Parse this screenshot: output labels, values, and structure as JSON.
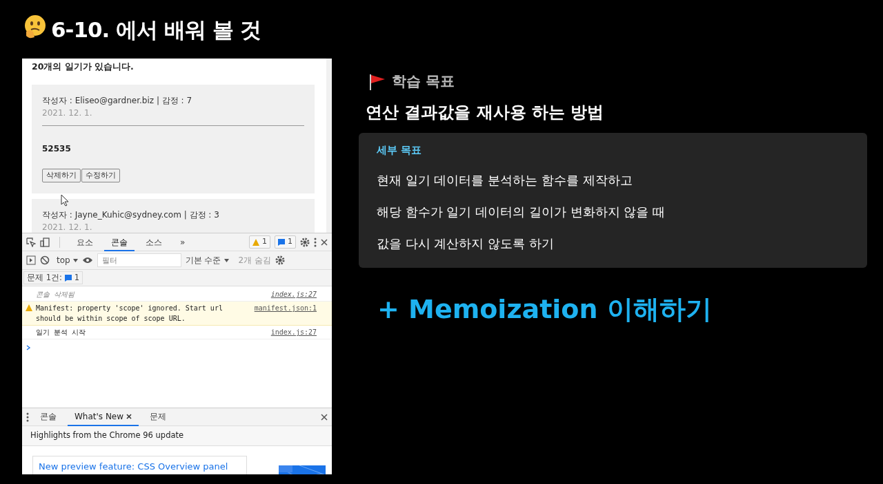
{
  "slide_title": "6-10. 에서 배워 볼 것",
  "browser": {
    "heading": "20개의 일기가 있습니다.",
    "diaries": [
      {
        "author_line": "작성자 : Eliseo@gardner.biz | 감정 : 7",
        "date": "2021. 12. 1.",
        "content": "52535",
        "buttons": [
          "삭제하기",
          "수정하기"
        ]
      },
      {
        "author_line": "작성자 : Jayne_Kuhic@sydney.com | 감정 : 3",
        "date": "2021. 12. 1."
      }
    ]
  },
  "devtools": {
    "tabs": [
      {
        "label": "요소",
        "selected": false
      },
      {
        "label": "콘솔",
        "selected": true
      },
      {
        "label": "소스",
        "selected": false
      }
    ],
    "more": "»",
    "warning_count": "1",
    "info_count": "1",
    "context": "top",
    "filter_placeholder": "필터",
    "level": "기본 수준",
    "hidden": "2개 숨김",
    "issues_label": "문제 1건:",
    "issues_count": "1",
    "messages": [
      {
        "kind": "info",
        "text": "콘솔 삭제됨",
        "source": "index.js:27"
      },
      {
        "kind": "warning",
        "text": "Manifest: property 'scope' ignored. Start url should be within scope of scope URL.",
        "source": "manifest.json:1"
      },
      {
        "kind": "log",
        "text": "일기 분석 시작",
        "source": "index.js:27"
      }
    ],
    "drawer_tabs": [
      {
        "label": "콘솔",
        "selected": false,
        "closable": false
      },
      {
        "label": "What's New",
        "selected": true,
        "closable": true
      },
      {
        "label": "문제",
        "selected": false,
        "closable": false
      }
    ],
    "whats_new_heading": "Highlights from the Chrome 96 update",
    "feature_link": "New preview feature: CSS Overview panel"
  },
  "goals": {
    "label": "학습 목표",
    "headline": "연산 결과값을 재사용 하는 방법",
    "detail_label": "세부 목표",
    "details": [
      "현재 일기 데이터를 분석하는 함수를 제작하고",
      "해당 함수가 일기 데이터의 길이가 변화하지 않을 때",
      "값을 다시 계산하지 않도록 하기"
    ]
  },
  "extra": "+ Memoization 이해하기"
}
